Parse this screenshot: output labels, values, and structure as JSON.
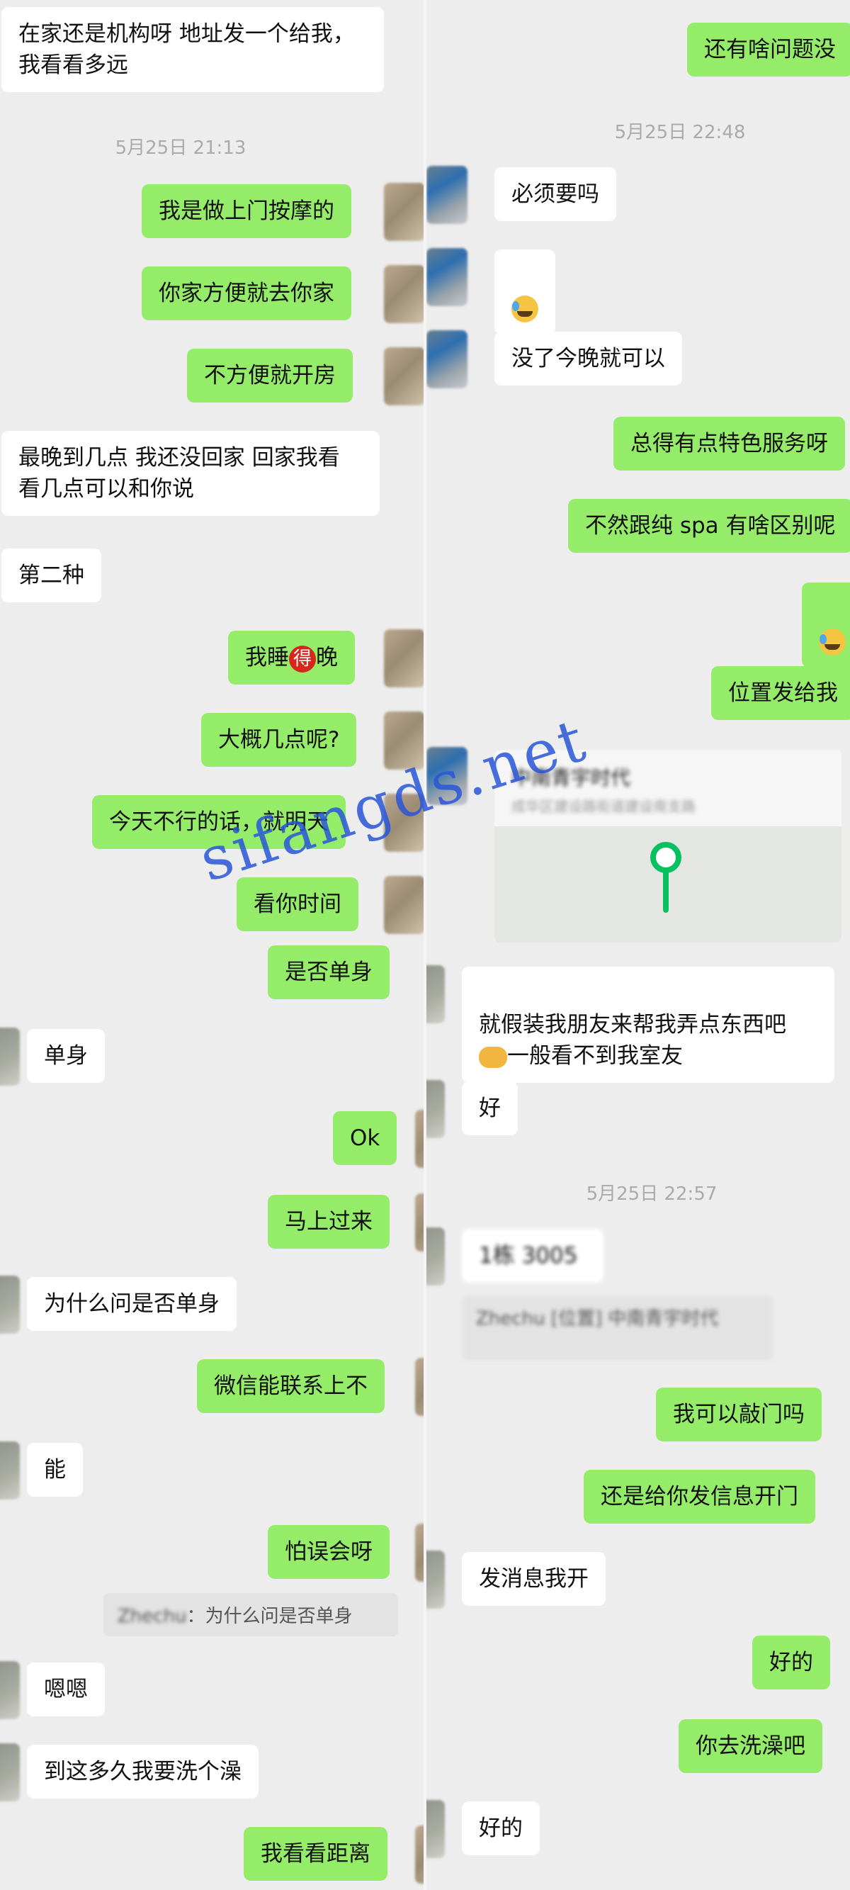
{
  "left_chat": {
    "msg_address": "在家还是机构呀 地址发一个给我，\n我看看多远",
    "time_1": "5月25日 21:13",
    "msg_doorstep": "我是做上门按摩的",
    "msg_go_home": "你家方便就去你家",
    "msg_hotel": "不方便就开房",
    "msg_latest": "最晚到几点 我还没回家 回家我看\n看几点可以和你说",
    "msg_second": "第二种",
    "msg_sleep_pre": "我睡",
    "msg_sleep_badge": "得",
    "msg_sleep_post": "晚",
    "msg_what_time": "大概几点呢?",
    "msg_tomorrow": "今天不行的话，就明天",
    "msg_your_time": "看你时间",
    "msg_single_q": "是否单身",
    "msg_single": "单身",
    "msg_ok": "Ok",
    "msg_coming": "马上过来",
    "msg_why_single": "为什么问是否单身",
    "msg_wechat": "微信能联系上不",
    "msg_can": "能",
    "msg_misunderstand": "怕误会呀",
    "quote_sender": "Zhechu",
    "quote_sep": "：",
    "quote_text": "为什么问是否单身",
    "msg_enen": "嗯嗯",
    "msg_shower": "到这多久我要洗个澡",
    "msg_distance": "我看看距离"
  },
  "right_chat": {
    "msg_any_question": "还有啥问题没",
    "time_1": "5月25日 22:48",
    "msg_must": "必须要吗",
    "msg_tonight": "没了今晚就可以",
    "msg_special": "总得有点特色服务呀",
    "msg_spa": "不然跟纯 spa 有啥区别呢",
    "msg_location": "位置发给我",
    "location_title": "中南青宇时代",
    "location_address": "成华区建设路街道建设南支路",
    "msg_pretend_1": "就假装我朋友来帮我弄点东西吧",
    "msg_pretend_2": "一般看不到我室友",
    "msg_good": "好",
    "time_2": "5月25日 22:57",
    "msg_room": "1栋 3005",
    "quote_sender": "Zhechu",
    "quote_text": "[位置] 中南青宇时代",
    "msg_knock": "我可以敲门吗",
    "msg_message": "还是给你发信息开门",
    "msg_send_open": "发消息我开",
    "msg_haode": "好的",
    "msg_go_shower": "你去洗澡吧",
    "msg_haode_2": "好的"
  },
  "watermark": "sifangds.net",
  "colors": {
    "background": "#ededed",
    "sent_bubble": "#95ec69",
    "received_bubble": "#ffffff",
    "timestamp": "#aaaaaa",
    "watermark": "#2a56d9",
    "location_pin": "#07c160"
  },
  "icons": {
    "sweat_laugh": "sweat-laugh-emoji-icon",
    "handshake": "handshake-emoji-icon",
    "location_pin": "location-pin-icon"
  }
}
